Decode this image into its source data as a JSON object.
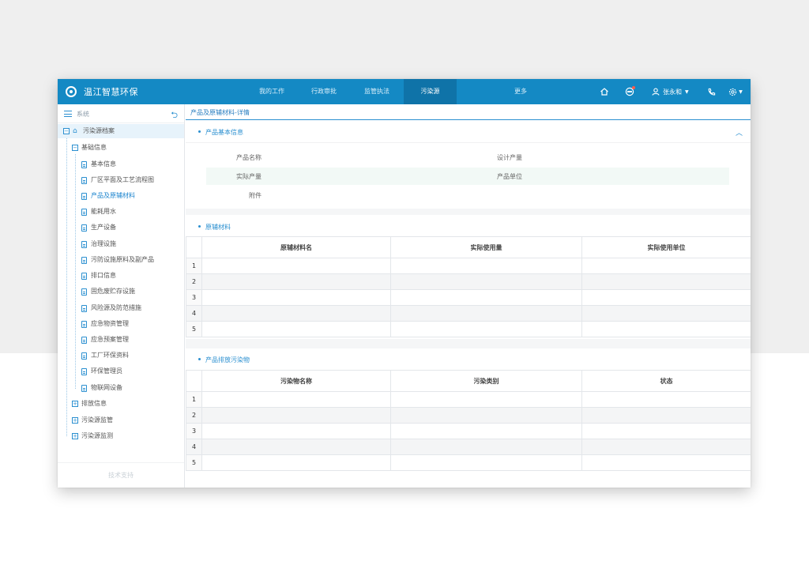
{
  "app": {
    "title": "温江智慧环保"
  },
  "nav": [
    {
      "label": "我的工作",
      "active": false
    },
    {
      "label": "行政审批",
      "active": false
    },
    {
      "label": "监管执法",
      "active": false
    },
    {
      "label": "污染源",
      "active": true
    },
    {
      "label": "更多",
      "active": false
    }
  ],
  "user": {
    "name": "张永和"
  },
  "sidebar": {
    "title": "系统",
    "root": "污染源档案",
    "group": "基础信息",
    "items": [
      {
        "label": "基本信息",
        "active": false
      },
      {
        "label": "厂区平面及工艺流程图",
        "active": false
      },
      {
        "label": "产品及原辅材料",
        "active": true
      },
      {
        "label": "能耗用水",
        "active": false
      },
      {
        "label": "生产设备",
        "active": false
      },
      {
        "label": "治理设施",
        "active": false
      },
      {
        "label": "污防设施原料及副产品",
        "active": false
      },
      {
        "label": "排口信息",
        "active": false
      },
      {
        "label": "固危废贮存设施",
        "active": false
      },
      {
        "label": "风险源及防范措施",
        "active": false
      },
      {
        "label": "应急物资管理",
        "active": false
      },
      {
        "label": "应急预案管理",
        "active": false
      },
      {
        "label": "工厂环保资料",
        "active": false
      },
      {
        "label": "环保管理员",
        "active": false
      },
      {
        "label": "物联网设备",
        "active": false
      }
    ],
    "collapsed": [
      "排放信息",
      "污染源监管",
      "污染源监测"
    ],
    "footer": "技术支持"
  },
  "breadcrumb": "产品及原辅材料-详情",
  "basic_info": {
    "title": "产品基本信息",
    "fields": [
      {
        "label": "产品名称",
        "value": ""
      },
      {
        "label": "设计产量",
        "value": ""
      },
      {
        "label": "实际产量",
        "value": ""
      },
      {
        "label": "产品单位",
        "value": ""
      },
      {
        "label": "附件",
        "value": ""
      }
    ]
  },
  "materials": {
    "title": "原辅材料",
    "columns": [
      "原辅材料名",
      "实际使用量",
      "实际使用单位"
    ],
    "rows": [
      {
        "index": "1",
        "cells": [
          "",
          "",
          ""
        ]
      },
      {
        "index": "2",
        "cells": [
          "",
          "",
          ""
        ]
      },
      {
        "index": "3",
        "cells": [
          "",
          "",
          ""
        ]
      },
      {
        "index": "4",
        "cells": [
          "",
          "",
          ""
        ]
      },
      {
        "index": "5",
        "cells": [
          "",
          "",
          ""
        ]
      }
    ]
  },
  "pollutants": {
    "title": "产品排放污染物",
    "columns": [
      "污染物名称",
      "污染类别",
      "状态"
    ],
    "rows": [
      {
        "index": "1",
        "cells": [
          "",
          "",
          ""
        ]
      },
      {
        "index": "2",
        "cells": [
          "",
          "",
          ""
        ]
      },
      {
        "index": "3",
        "cells": [
          "",
          "",
          ""
        ]
      },
      {
        "index": "4",
        "cells": [
          "",
          "",
          ""
        ]
      },
      {
        "index": "5",
        "cells": [
          "",
          "",
          ""
        ]
      }
    ]
  },
  "colors": {
    "primary": "#1489c4",
    "nav_active": "#0f73a8",
    "accent": "#2a8fd0"
  },
  "icons": {
    "logo": "logo-icon",
    "home": "home-icon",
    "message": "message-icon",
    "user": "user-icon",
    "phone": "phone-icon",
    "settings": "gear-icon"
  }
}
